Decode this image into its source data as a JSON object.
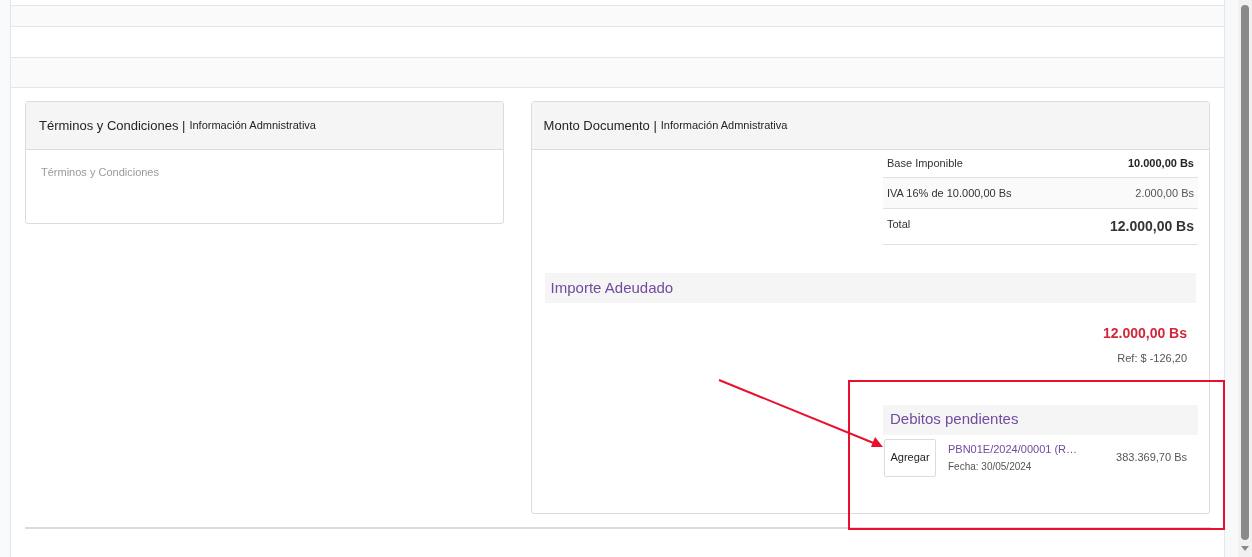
{
  "terms_card": {
    "title": "Términos y Condiciones |",
    "subtitle": "Información Admnistrativa",
    "placeholder": "Términos y Condiciones"
  },
  "amount_card": {
    "title": "Monto Documento |",
    "subtitle": "Información Admnistrativa",
    "totals": [
      {
        "kind": "subtotal",
        "label": "Base Imponible",
        "value": "10.000,00 Bs"
      },
      {
        "kind": "tax",
        "label": "IVA 16% de 10.000,00 Bs",
        "value": "2.000,00 Bs"
      },
      {
        "kind": "total",
        "label": "Total",
        "value": "12.000,00 Bs"
      }
    ],
    "due": {
      "title": "Importe Adeudado",
      "amount": "12.000,00 Bs",
      "reference": "Ref: $ -126,20"
    },
    "pending": {
      "title": "Debitos pendientes",
      "items": [
        {
          "button": "Agregar",
          "document": "PBN01E/2024/00001 (R…",
          "date": "Fecha: 30/05/2024",
          "amount": "383.369,70 Bs"
        }
      ]
    }
  }
}
